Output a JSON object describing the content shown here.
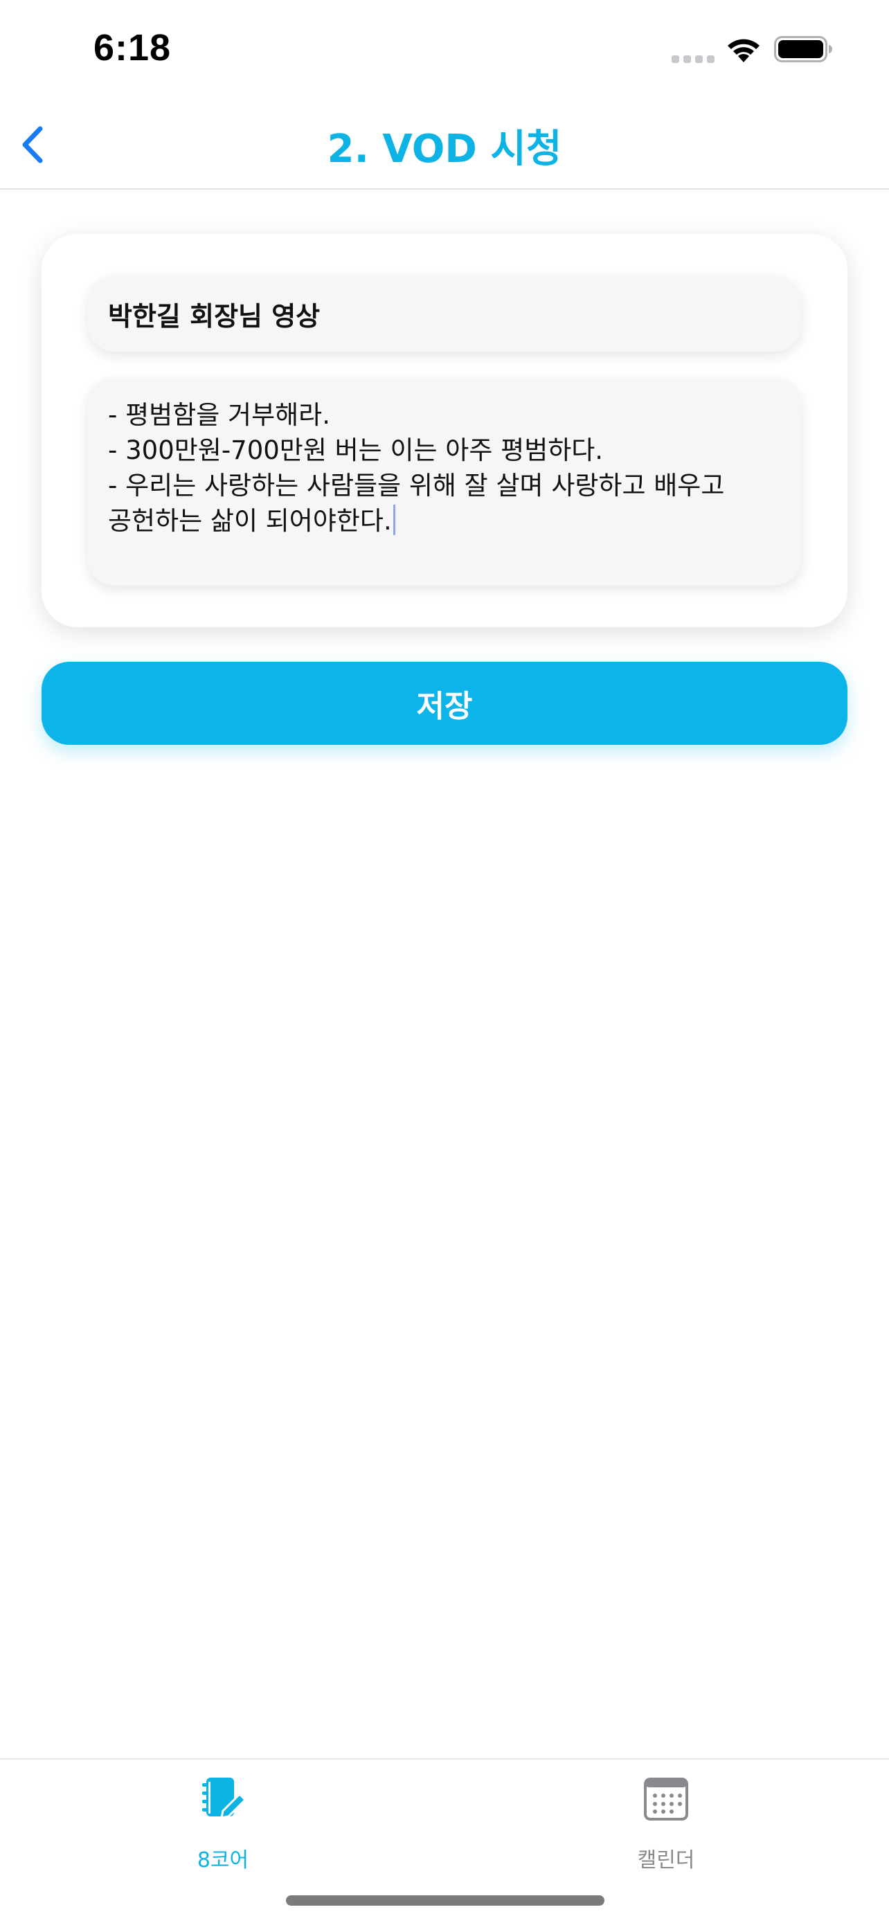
{
  "status_bar": {
    "time": "6:18",
    "icons": [
      "signal-icon",
      "wifi-icon",
      "battery-icon"
    ]
  },
  "nav": {
    "title": "2. VOD 시청",
    "back_icon": "chevron-left-icon"
  },
  "form": {
    "title_value": "박한길 회장님 영상",
    "memo_lines": [
      "- 평범함을 거부해라.",
      "- 300만원-700만원 버는 이는 아주 평범하다.",
      "- 우리는 사랑하는 사람들을 위해 잘 살며 사랑하고 배우고",
      "공헌하는 삶이 되어야한다."
    ]
  },
  "save_button": {
    "label": "저장"
  },
  "tab_bar": {
    "tabs": [
      {
        "label": "8코어",
        "icon": "notebook-pencil-icon",
        "selected": true
      },
      {
        "label": "캘린더",
        "icon": "calendar-icon",
        "selected": false
      }
    ]
  },
  "colors": {
    "accent": "#0eb3e6",
    "button": "#0db4e9",
    "back_chevron": "#1a7cf5",
    "field_bg": "#f6f6f6",
    "inactive_tab": "#8a8a8e"
  }
}
